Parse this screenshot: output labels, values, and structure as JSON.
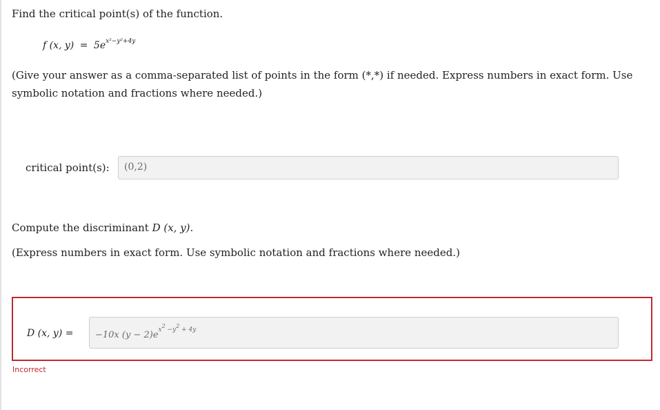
{
  "q1": {
    "prompt": "Find the critical point(s) of the function.",
    "func_lhs": "f (x, y)",
    "func_eq": "=",
    "func_coef": "5e",
    "func_exp": "x²−y²+4y",
    "instructions_line1": "(Give your answer as a comma-separated list of points in the form (*,*) if needed. Express numbers in exact form. Use",
    "instructions_line2": "symbolic notation and fractions where needed.)",
    "answer_label": "critical point(s):",
    "answer_value": "(0,2)"
  },
  "q2": {
    "prompt_prefix": "Compute the discriminant",
    "prompt_math": "D (x, y)",
    "prompt_suffix": ".",
    "instructions": "(Express numbers in exact form. Use symbolic notation and fractions where needed.)",
    "answer_label": "D (x, y) =",
    "answer_value_main": "−10x (y − 2)e",
    "answer_value_exp": "x",
    "answer_value_exp2": "2",
    "answer_value_exp3": " −y",
    "answer_value_exp4": "2",
    "answer_value_exp5": " + 4y",
    "status": "Incorrect"
  },
  "colors": {
    "error": "#c1272d",
    "field_bg": "#f2f2f2"
  }
}
